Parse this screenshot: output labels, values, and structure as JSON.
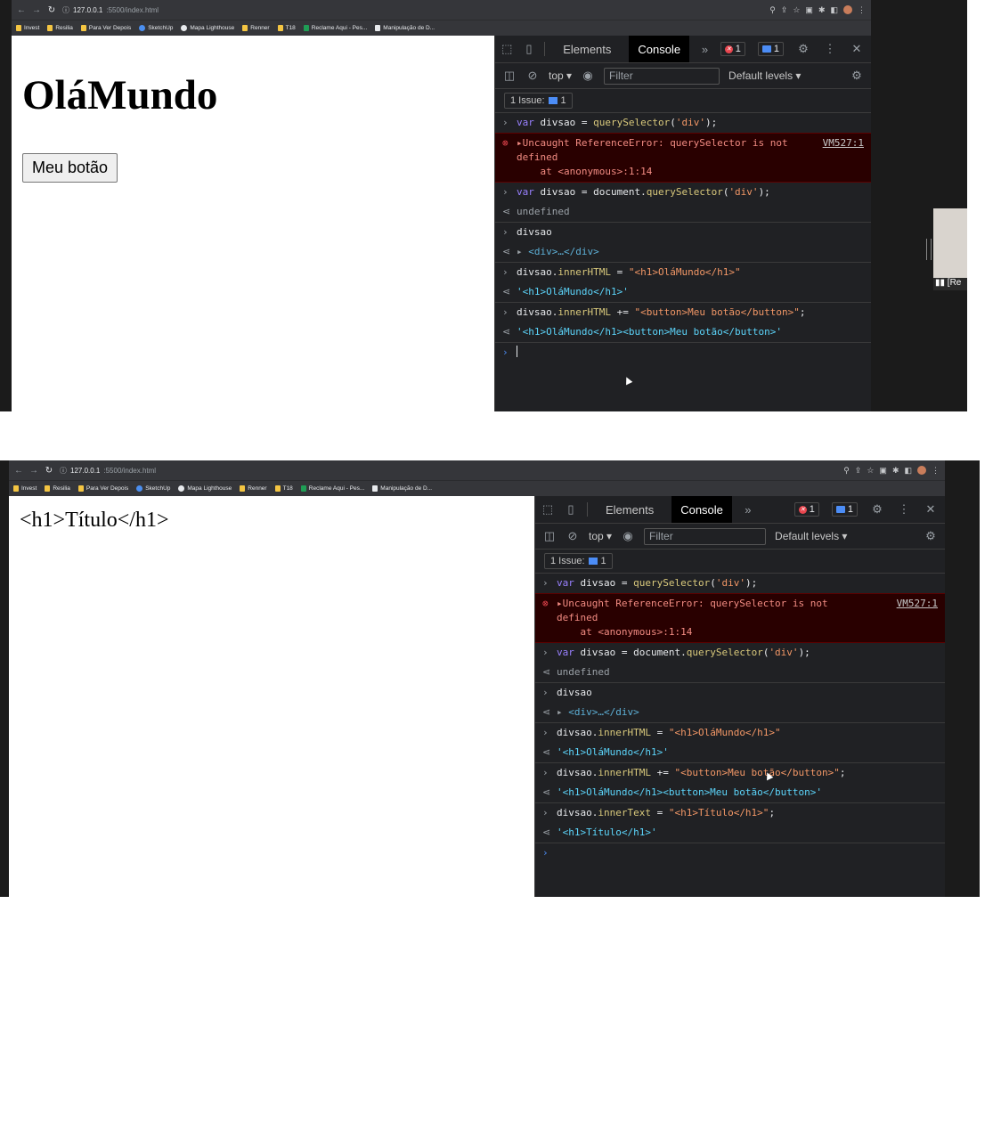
{
  "screenshots": [
    {
      "address": {
        "host": "127.0.0.1",
        "path": ":5500/index.html"
      },
      "bookmarks": [
        "Invest",
        "Resilia",
        "Para Ver Depois",
        "SketchUp",
        "Mapa Lighthouse",
        "Renner",
        "T18",
        "Reclame Aqui - Pes...",
        "Manipulação de D..."
      ],
      "page": {
        "heading": "OláMundo",
        "button": "Meu botão"
      },
      "devtools": {
        "tabs": [
          "Elements",
          "Console"
        ],
        "error_count": "1",
        "message_count": "1",
        "context": "top",
        "filter_placeholder": "Filter",
        "levels": "Default levels",
        "issue_label": "1 Issue:",
        "issue_count": "1",
        "console": [
          {
            "type": "input",
            "text": "var divsao = querySelector('div');"
          },
          {
            "type": "error",
            "text": "Uncaught ReferenceError: querySelector is not\ndefined\n    at <anonymous>:1:14",
            "link": "VM527:1"
          },
          {
            "type": "input",
            "text": "var divsao = document.querySelector('div');"
          },
          {
            "type": "return",
            "text": "undefined"
          },
          {
            "type": "input",
            "text": "divsao"
          },
          {
            "type": "return-el",
            "text": "<div>…</div>"
          },
          {
            "type": "input",
            "text": "divsao.innerHTML = \"<h1>OláMundo</h1>\""
          },
          {
            "type": "return-str",
            "text": "'<h1>OláMundo</h1>'"
          },
          {
            "type": "input",
            "text": "divsao.innerHTML += \"<button>Meu botão</button>\";"
          },
          {
            "type": "return-str",
            "text": "'<h1>OláMundo</h1><button>Meu botão</button>'"
          }
        ]
      },
      "video_label": "[Re"
    },
    {
      "address": {
        "host": "127.0.0.1",
        "path": ":5500/index.html"
      },
      "bookmarks": [
        "Invest",
        "Resilia",
        "Para Ver Depois",
        "SketchUp",
        "Mapa Lighthouse",
        "Renner",
        "T18",
        "Reclame Aqui - Pes...",
        "Manipulação de D..."
      ],
      "page": {
        "text": "<h1>Título</h1>"
      },
      "devtools": {
        "tabs": [
          "Elements",
          "Console"
        ],
        "error_count": "1",
        "message_count": "1",
        "context": "top",
        "filter_placeholder": "Filter",
        "levels": "Default levels",
        "issue_label": "1 Issue:",
        "issue_count": "1",
        "console": [
          {
            "type": "input",
            "text": "var divsao = querySelector('div');"
          },
          {
            "type": "error",
            "text": "Uncaught ReferenceError: querySelector is not\ndefined\n    at <anonymous>:1:14",
            "link": "VM527:1"
          },
          {
            "type": "input",
            "text": "var divsao = document.querySelector('div');"
          },
          {
            "type": "return",
            "text": "undefined"
          },
          {
            "type": "input",
            "text": "divsao"
          },
          {
            "type": "return-el",
            "text": "<div>…</div>"
          },
          {
            "type": "input",
            "text": "divsao.innerHTML = \"<h1>OláMundo</h1>\""
          },
          {
            "type": "return-str",
            "text": "'<h1>OláMundo</h1>'"
          },
          {
            "type": "input",
            "text": "divsao.innerHTML += \"<button>Meu botão</button>\";"
          },
          {
            "type": "return-str",
            "text": "'<h1>OláMundo</h1><button>Meu botão</button>'"
          },
          {
            "type": "input",
            "text": "divsao.innerText = \"<h1>Título</h1>\";"
          },
          {
            "type": "return-str",
            "text": "'<h1>Título</h1>'"
          }
        ]
      }
    }
  ],
  "colors": {
    "devtools_bg": "#202124",
    "error_bg": "#290000",
    "error_text": "#f28b82",
    "return_string": "#5cd5fb",
    "accent": "#4c8df6"
  }
}
